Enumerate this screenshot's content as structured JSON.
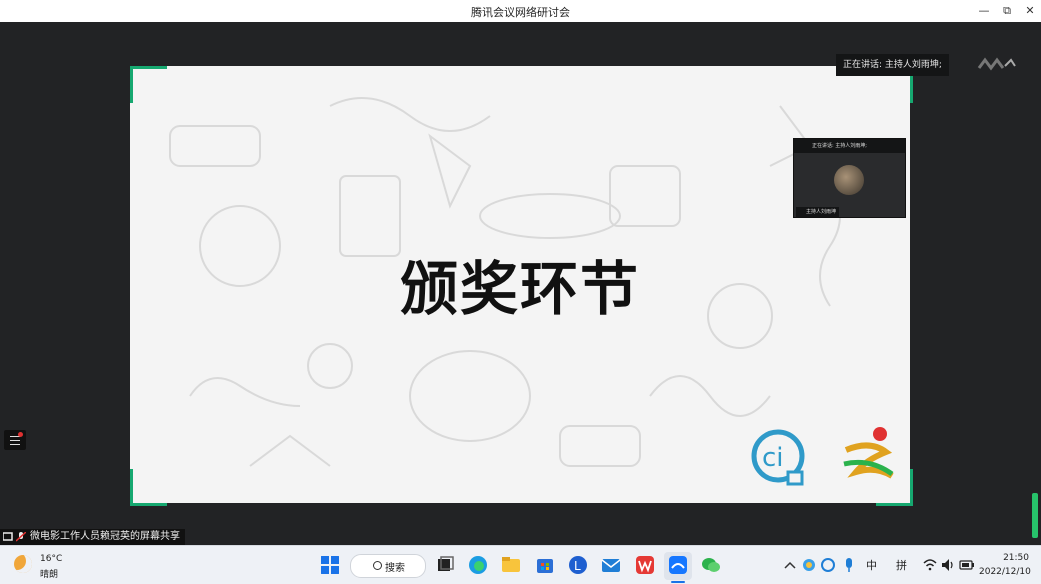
{
  "window": {
    "title": "腾讯会议网络研讨会",
    "buttons": {
      "minimize": "—",
      "restore": "⧉",
      "close": "✕"
    }
  },
  "meeting": {
    "speaking_label": "正在讲话: 主持人刘雨坤;",
    "slide_title": "颁奖环节",
    "pip": {
      "speaking_label": "正在讲话: 主持人刘雨坤;",
      "name_tag": "主持人刘雨坤"
    },
    "share_status": "微电影工作人员赖冠英的屏幕共享"
  },
  "taskbar": {
    "weather": {
      "temperature": "16°C",
      "condition": "晴朗"
    },
    "search_label": "搜索",
    "apps": [
      "start-icon",
      "search",
      "task-view-icon",
      "edge-icon",
      "file-explorer-icon",
      "store-icon",
      "app-blue-icon",
      "mail-icon",
      "wps-icon",
      "tencent-meeting-icon",
      "wechat-icon"
    ],
    "tray": {
      "ime_lang": "中",
      "ime_mode": "拼"
    },
    "clock": {
      "time": "21:50",
      "date": "2022/12/10"
    }
  },
  "colors": {
    "accent_green": "#16a870",
    "windows_blue": "#1a73e8",
    "logo_blue": "#2f9ac9",
    "logo_red": "#e03131"
  }
}
